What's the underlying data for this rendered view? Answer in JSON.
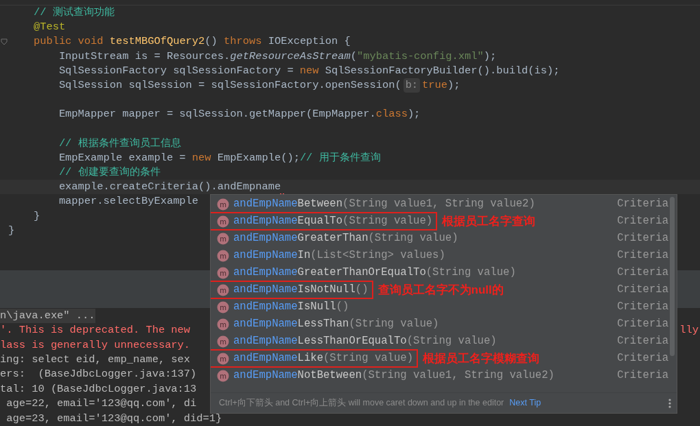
{
  "code_lines": [
    {
      "segments": [
        {
          "kind": "comment",
          "text": "    // 测试查询功能"
        }
      ]
    },
    {
      "segments": [
        {
          "kind": "annotation",
          "text": "    @Test"
        }
      ]
    },
    {
      "fold": true,
      "segments": [
        {
          "kind": "keyword",
          "text": "    public void "
        },
        {
          "kind": "declaration",
          "text": "testMBGOfQuery2"
        },
        {
          "kind": "plain",
          "text": "() "
        },
        {
          "kind": "keyword",
          "text": "throws "
        },
        {
          "kind": "plain",
          "text": "IOException {"
        }
      ]
    },
    {
      "segments": [
        {
          "kind": "plain",
          "text": "        InputStream is = Resources."
        },
        {
          "kind": "static",
          "text": "getResourceAsStream"
        },
        {
          "kind": "plain",
          "text": "("
        },
        {
          "kind": "string",
          "text": "\"mybatis-config.xml\""
        },
        {
          "kind": "plain",
          "text": ");"
        }
      ]
    },
    {
      "segments": [
        {
          "kind": "plain",
          "text": "        SqlSessionFactory sqlSessionFactory = "
        },
        {
          "kind": "keyword",
          "text": "new "
        },
        {
          "kind": "plain",
          "text": "SqlSessionFactoryBuilder().build(is);"
        }
      ]
    },
    {
      "segments": [
        {
          "kind": "plain",
          "text": "        SqlSession sqlSession = sqlSessionFactory.openSession("
        },
        {
          "kind": "hint",
          "text": "b:"
        },
        {
          "kind": "keyword",
          "text": "true"
        },
        {
          "kind": "plain",
          "text": ");"
        }
      ]
    },
    {
      "kind": "blank"
    },
    {
      "segments": [
        {
          "kind": "plain",
          "text": "        EmpMapper mapper = sqlSession.getMapper(EmpMapper."
        },
        {
          "kind": "keyword",
          "text": "class"
        },
        {
          "kind": "plain",
          "text": ");"
        }
      ]
    },
    {
      "kind": "blank"
    },
    {
      "segments": [
        {
          "kind": "comment",
          "text": "        // 根据条件查询员工信息"
        }
      ]
    },
    {
      "segments": [
        {
          "kind": "plain",
          "text": "        EmpExample example = "
        },
        {
          "kind": "keyword",
          "text": "new "
        },
        {
          "kind": "plain",
          "text": "EmpExample();"
        },
        {
          "kind": "comment",
          "text": "// 用于条件查询"
        }
      ]
    },
    {
      "segments": [
        {
          "kind": "comment",
          "text": "        // 创建要查询的条件"
        }
      ]
    },
    {
      "current": true,
      "error": true,
      "segments": [
        {
          "kind": "plain",
          "text": "        example.createCriteria().andEmpname"
        }
      ]
    },
    {
      "segments": [
        {
          "kind": "plain",
          "text": "        mapper.selectByExample"
        }
      ]
    },
    {
      "segments": [
        {
          "kind": "plain",
          "text": "    }"
        }
      ]
    },
    {
      "segments": [
        {
          "kind": "plain",
          "text": "}"
        }
      ]
    }
  ],
  "console_lines": [
    {
      "kind": "command",
      "text": "n\\java.exe\" ..."
    },
    {
      "kind": "error",
      "text": "'. This is deprecated. The new",
      "tail": "lly"
    },
    {
      "kind": "error",
      "text": "lass is generally unnecessary."
    },
    {
      "kind": "log",
      "text": "ing: select eid, emp_name, sex"
    },
    {
      "kind": "log",
      "text": "ers:  (BaseJdbcLogger.java:137)"
    },
    {
      "kind": "log",
      "text": "tal: 10 (BaseJdbcLogger.java:13"
    },
    {
      "kind": "log",
      "text": " age=22, email='123@qq.com', di"
    },
    {
      "kind": "log",
      "text": " age=23, email='123@qq.com', did=1}"
    }
  ],
  "completion": {
    "items": [
      {
        "icon": "m",
        "match": "andEmpName",
        "rest": "Between",
        "params": "(String value1, String value2)",
        "type": "Criteria"
      },
      {
        "icon": "m",
        "match": "andEmpName",
        "rest": "EqualTo",
        "params": "(String value)",
        "type": "Criteria",
        "note": "根据员工名字查询"
      },
      {
        "icon": "m",
        "match": "andEmpName",
        "rest": "GreaterThan",
        "params": "(String value)",
        "type": "Criteria"
      },
      {
        "icon": "m",
        "match": "andEmpName",
        "rest": "In",
        "params": "(List<String> values)",
        "type": "Criteria"
      },
      {
        "icon": "m",
        "match": "andEmpName",
        "rest": "GreaterThanOrEqualTo",
        "params": "(String value)",
        "type": "Criteria"
      },
      {
        "icon": "m",
        "match": "andEmpName",
        "rest": "IsNotNull",
        "params": "()",
        "type": "Criteria",
        "note": "查询员工名字不为null的"
      },
      {
        "icon": "m",
        "match": "andEmpName",
        "rest": "IsNull",
        "params": "()",
        "type": "Criteria"
      },
      {
        "icon": "m",
        "match": "andEmpName",
        "rest": "LessThan",
        "params": "(String value)",
        "type": "Criteria"
      },
      {
        "icon": "m",
        "match": "andEmpName",
        "rest": "LessThanOrEqualTo",
        "params": "(String value)",
        "type": "Criteria"
      },
      {
        "icon": "m",
        "match": "andEmpName",
        "rest": "Like",
        "params": "(String value)",
        "type": "Criteria",
        "note": "根据员工名字模糊查询"
      },
      {
        "icon": "m",
        "match": "andEmpName",
        "rest": "NotBetween",
        "params": "(String value1, String value2)",
        "type": "Criteria"
      }
    ],
    "tip": "Ctrl+向下箭头 and Ctrl+向上箭头 will move caret down and up in the editor",
    "tip_link": "Next Tip"
  }
}
